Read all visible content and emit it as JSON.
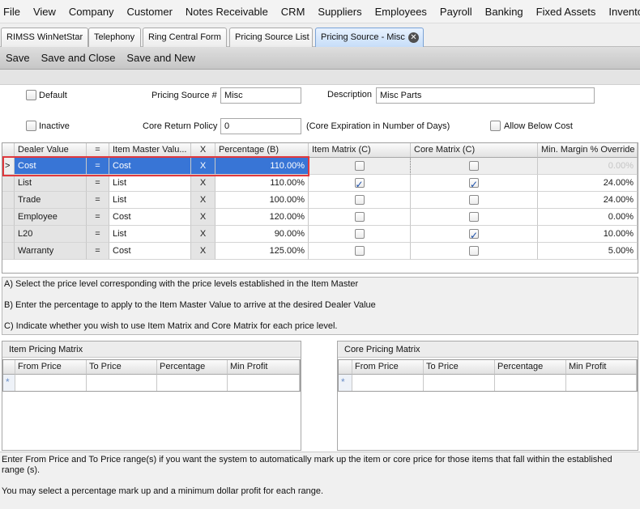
{
  "menu": [
    "File",
    "View",
    "Company",
    "Customer",
    "Notes Receivable",
    "CRM",
    "Suppliers",
    "Employees",
    "Payroll",
    "Banking",
    "Fixed Assets",
    "Invento"
  ],
  "tabs": [
    {
      "label": "RIMSS WinNetStar"
    },
    {
      "label": "Telephony"
    },
    {
      "label": "Ring Central Form"
    },
    {
      "label": "Pricing Source List"
    },
    {
      "label": "Pricing Source - Misc"
    }
  ],
  "toolbar": {
    "save": "Save",
    "save_close": "Save and Close",
    "save_new": "Save and New"
  },
  "form": {
    "default_label": "Default",
    "inactive_label": "Inactive",
    "pricing_source_label": "Pricing Source #",
    "pricing_source_value": "Misc",
    "description_label": "Description",
    "description_value": "Misc Parts",
    "core_return_label": "Core Return Policy",
    "core_return_value": "0",
    "core_expiration_note": "(Core Expiration in Number of Days)",
    "allow_below_cost_label": "Allow Below Cost"
  },
  "grid": {
    "headers": {
      "dealer_value": "Dealer Value",
      "eq": "=",
      "item_master": "Item Master Valu...",
      "x": "X",
      "percentage": "Percentage (B)",
      "item_matrix": "Item Matrix (C)",
      "core_matrix": "Core Matrix (C)",
      "min_margin": "Min. Margin % Override"
    },
    "rows": [
      {
        "indicator": ">",
        "dealer": "Cost",
        "eq": "=",
        "master": "Cost",
        "x": "X",
        "pct": "110.00%",
        "item_matrix": false,
        "core_matrix": false,
        "margin": "0.00%"
      },
      {
        "indicator": "",
        "dealer": "List",
        "eq": "=",
        "master": "List",
        "x": "X",
        "pct": "110.00%",
        "item_matrix": true,
        "core_matrix": true,
        "margin": "24.00%"
      },
      {
        "indicator": "",
        "dealer": "Trade",
        "eq": "=",
        "master": "List",
        "x": "X",
        "pct": "100.00%",
        "item_matrix": false,
        "core_matrix": false,
        "margin": "24.00%"
      },
      {
        "indicator": "",
        "dealer": "Employee",
        "eq": "=",
        "master": "Cost",
        "x": "X",
        "pct": "120.00%",
        "item_matrix": false,
        "core_matrix": false,
        "margin": "0.00%"
      },
      {
        "indicator": "",
        "dealer": "L20",
        "eq": "=",
        "master": "List",
        "x": "X",
        "pct": "90.00%",
        "item_matrix": false,
        "core_matrix": true,
        "margin": "10.00%"
      },
      {
        "indicator": "",
        "dealer": "Warranty",
        "eq": "=",
        "master": "Cost",
        "x": "X",
        "pct": "125.00%",
        "item_matrix": false,
        "core_matrix": false,
        "margin": "5.00%"
      }
    ]
  },
  "instructions": {
    "a": "A)  Select the price level corresponding with the price levels established in the Item Master",
    "b": "B)  Enter the percentage to apply to the Item Master Value to arrive at the desired Dealer Value",
    "c": "C)  Indicate whether you wish to use Item Matrix and Core Matrix for each price level."
  },
  "item_matrix": {
    "title": "Item Pricing Matrix",
    "headers": {
      "from": "From Price",
      "to": "To Price",
      "pct": "Percentage",
      "min": "Min Profit"
    },
    "new_row": "*"
  },
  "core_matrix": {
    "title": "Core Pricing Matrix",
    "headers": {
      "from": "From Price",
      "to": "To Price",
      "pct": "Percentage",
      "min": "Min Profit"
    },
    "new_row": "*"
  },
  "footer": {
    "line1": "Enter From Price and To Price range(s) if you want the system to automatically mark up the item or core price for those items that fall within the established range (s).",
    "line2": "You may select a percentage mark up and a minimum dollar profit for each range."
  },
  "colors": {
    "selection": "#3875d6",
    "highlight_box": "#e0393e",
    "active_tab": "#c6ddf8"
  }
}
